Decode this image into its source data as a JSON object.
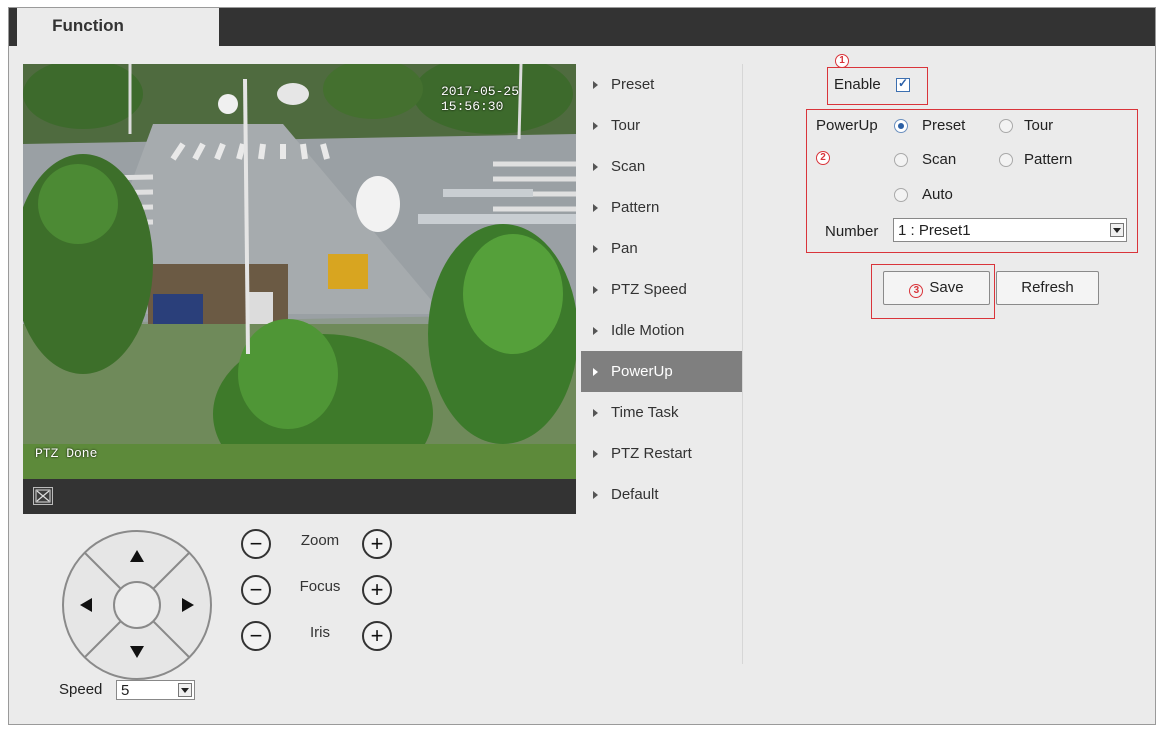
{
  "tab": {
    "label": "Function"
  },
  "video": {
    "timestamp": "2017-05-25 15:56:30",
    "status_osd": "PTZ Done"
  },
  "menu": {
    "items": [
      {
        "label": "Preset",
        "active": false
      },
      {
        "label": "Tour",
        "active": false
      },
      {
        "label": "Scan",
        "active": false
      },
      {
        "label": "Pattern",
        "active": false
      },
      {
        "label": "Pan",
        "active": false
      },
      {
        "label": "PTZ Speed",
        "active": false
      },
      {
        "label": "Idle Motion",
        "active": false
      },
      {
        "label": "PowerUp",
        "active": true
      },
      {
        "label": "Time Task",
        "active": false
      },
      {
        "label": "PTZ Restart",
        "active": false
      },
      {
        "label": "Default",
        "active": false
      }
    ]
  },
  "ptz": {
    "zoom_label": "Zoom",
    "focus_label": "Focus",
    "iris_label": "Iris",
    "minus": "−",
    "plus": "+",
    "speed_label": "Speed",
    "speed_value": "5"
  },
  "config": {
    "step1": "1",
    "step2": "2",
    "step3": "3",
    "enable_label": "Enable",
    "enable_checked": true,
    "powerup_label": "PowerUp",
    "options": {
      "preset": "Preset",
      "tour": "Tour",
      "scan": "Scan",
      "pattern": "Pattern",
      "auto": "Auto"
    },
    "selected_option": "Preset",
    "number_label": "Number",
    "number_value": "1 : Preset1",
    "save_label": "Save",
    "refresh_label": "Refresh"
  },
  "colors": {
    "accent_red": "#d9343a",
    "topbar": "#333333",
    "menu_active": "#7f7f7f"
  }
}
